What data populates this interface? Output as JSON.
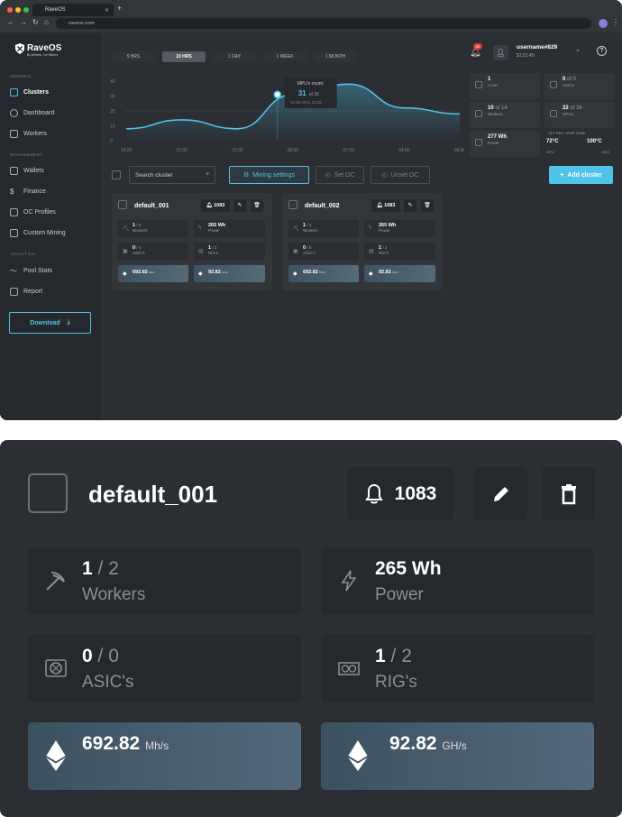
{
  "browser": {
    "tab_title": "RaveOS",
    "url": "raveos.com"
  },
  "logo": {
    "name": "RaveOS",
    "tagline": "By Miners. For Miners"
  },
  "sidebar": {
    "sections": {
      "general": "GENERAL",
      "management": "MANAGEMENT",
      "analytics": "ANALYTICS"
    },
    "items": [
      {
        "label": "Clusters",
        "icon": "grid-icon"
      },
      {
        "label": "Dashboard",
        "icon": "gauge-icon"
      },
      {
        "label": "Workers",
        "icon": "pickaxe-icon"
      },
      {
        "label": "Wallets",
        "icon": "wallet-icon"
      },
      {
        "label": "Finance",
        "icon": "dollar-icon"
      },
      {
        "label": "OC Profiles",
        "icon": "sliders-icon"
      },
      {
        "label": "Custom Mining",
        "icon": "tune-icon"
      },
      {
        "label": "Pool Stats",
        "icon": "trend-icon"
      },
      {
        "label": "Report",
        "icon": "report-icon"
      }
    ],
    "download_label": "Download"
  },
  "time_ranges": [
    "5 HRS",
    "10 HRS",
    "1 DAY",
    "1 WEEK",
    "1 MONTH"
  ],
  "time_range_selected": "10 HRS",
  "header": {
    "notification_count": "34",
    "username": "username#829",
    "balance": "$123.45"
  },
  "chart_data": {
    "type": "area",
    "x": [
      "18:00",
      "20:00",
      "22:00",
      "00:00",
      "02:00",
      "04:00",
      "06:00"
    ],
    "y_ticks": [
      "40",
      "30",
      "20",
      "10",
      "0"
    ],
    "ylim": [
      0,
      40
    ],
    "values": [
      8,
      14,
      8,
      31,
      38,
      22,
      18
    ],
    "grid": true,
    "tooltip": {
      "title": "MPU's count:",
      "value": "31",
      "of": "of 36",
      "time": "16.08.2021 23:33"
    }
  },
  "stats": [
    {
      "value": "1",
      "of": "",
      "label": "Coins"
    },
    {
      "value": "0",
      "of": "of 0",
      "label": "ASICs"
    },
    {
      "value": "10",
      "of": "of 14",
      "label": "Workers"
    },
    {
      "value": "22",
      "of": "of 36",
      "label": "GPUs"
    },
    {
      "value": "277 Wh",
      "of": "",
      "label": "Power"
    }
  ],
  "temp_zone": {
    "title": "SET RED TEMP ZONE",
    "gpu": "72°C",
    "asic": "100°C",
    "gpu_label": "GPU",
    "asic_label": "ASIC"
  },
  "toolbar": {
    "search_placeholder": "Search cluster",
    "mining_settings": "Mining settings",
    "set_oc": "Set OC",
    "unset_oc": "Unset OC",
    "add_cluster": "Add cluster"
  },
  "clusters": [
    {
      "name": "default_001",
      "alerts": "1083",
      "workers": "1",
      "workers_of": "/ 2",
      "workers_label": "Workers",
      "power": "265 Wh",
      "power_label": "Power",
      "asics": "0",
      "asics_of": "/ 0",
      "asics_label": "ASIC's",
      "rigs": "1",
      "rigs_of": "/ 2",
      "rigs_label": "RIG's",
      "hash1": "692.82",
      "hash1_unit": "Mh/s",
      "hash2": "92.82",
      "hash2_unit": "GH/s"
    },
    {
      "name": "default_002",
      "alerts": "1083",
      "workers": "1",
      "workers_of": "/ 2",
      "workers_label": "Workers",
      "power": "265 Wh",
      "power_label": "Power",
      "asics": "0",
      "asics_of": "/ 0",
      "asics_label": "ASIC's",
      "rigs": "1",
      "rigs_of": "/ 2",
      "rigs_label": "RIG's",
      "hash1": "692.82",
      "hash1_unit": "MH/s",
      "hash2": "92.82",
      "hash2_unit": "GH/s"
    }
  ],
  "zoom": {
    "name": "default_001",
    "alerts": "1083",
    "workers": "1",
    "workers_of": "/ 2",
    "workers_label": "Workers",
    "power": "265 Wh",
    "power_label": "Power",
    "asics": "0",
    "asics_of": "/ 0",
    "asics_label": "ASIC's",
    "rigs": "1",
    "rigs_of": "/ 2",
    "rigs_label": "RIG's",
    "hash1": "692.82",
    "hash1_unit": "Mh/s",
    "hash2": "92.82",
    "hash2_unit": "GH/s"
  },
  "colors": {
    "accent": "#4fc3e8",
    "bg": "#2b2e33",
    "panel": "#25282c",
    "badge": "#e53935"
  }
}
